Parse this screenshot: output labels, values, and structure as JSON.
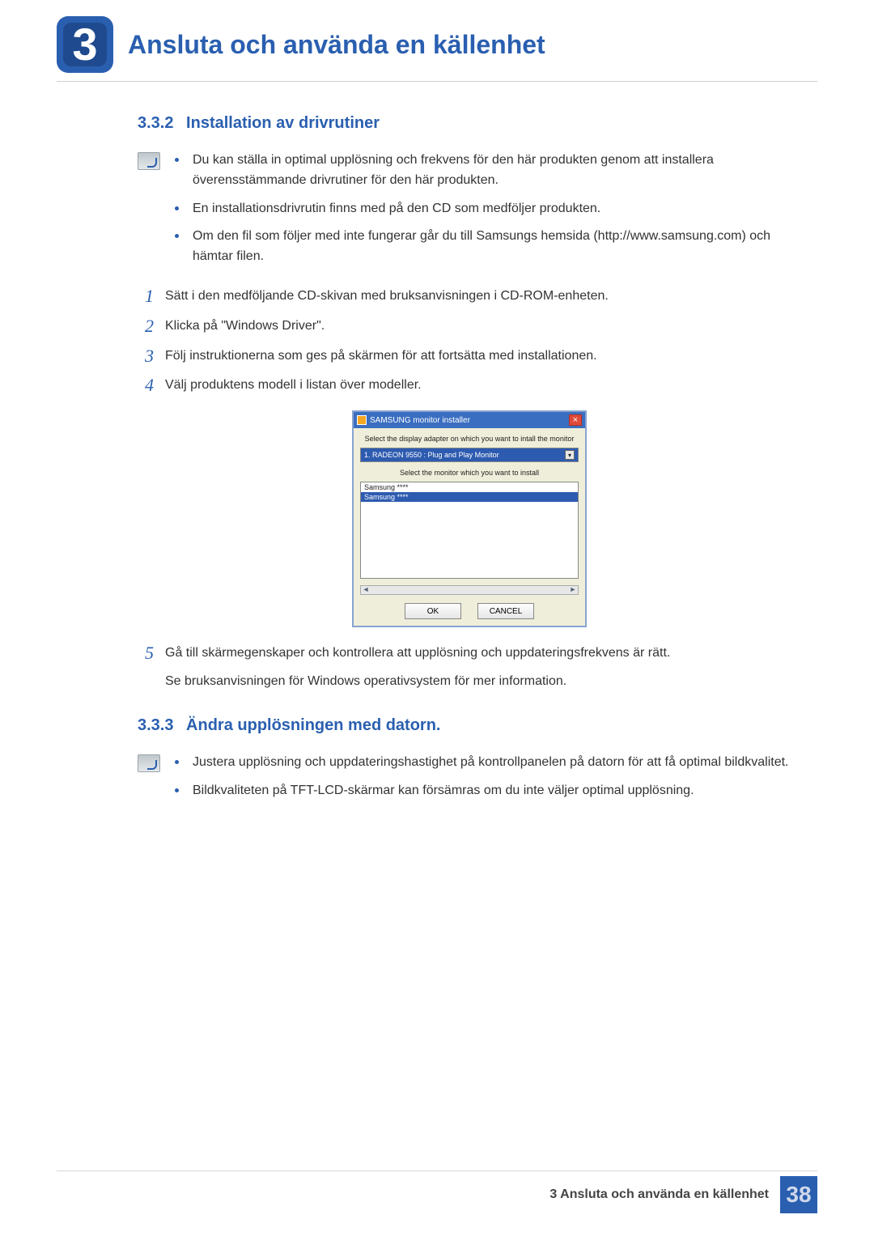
{
  "chapter": {
    "number": "3",
    "title": "Ansluta och använda en källenhet"
  },
  "sections": {
    "s1": {
      "num": "3.3.2",
      "title": "Installation av drivrutiner",
      "notes": [
        "Du kan ställa in optimal upplösning och frekvens för den här produkten genom att installera överensstämmande drivrutiner för den här produkten.",
        "En installationsdrivrutin finns med på den CD som medföljer produkten.",
        "Om den fil som följer med inte fungerar går du till Samsungs hemsida (http://www.samsung.com) och hämtar filen."
      ],
      "steps": [
        {
          "n": "1",
          "text": "Sätt i den medföljande CD-skivan med bruksanvisningen i CD-ROM-enheten."
        },
        {
          "n": "2",
          "text": "Klicka på \"Windows Driver\"."
        },
        {
          "n": "3",
          "text": "Följ instruktionerna som ges på skärmen för att fortsätta med installationen."
        },
        {
          "n": "4",
          "text": "Välj produktens modell i listan över modeller."
        },
        {
          "n": "5",
          "text": "Gå till skärmegenskaper och kontrollera att upplösning och uppdateringsfrekvens är rätt.",
          "sub": "Se bruksanvisningen för Windows operativsystem för mer information."
        }
      ]
    },
    "s2": {
      "num": "3.3.3",
      "title": "Ändra upplösningen med datorn.",
      "notes": [
        "Justera upplösning och uppdateringshastighet på kontrollpanelen på datorn för att få optimal bildkvalitet.",
        "Bildkvaliteten på TFT-LCD-skärmar kan försämras om du inte väljer optimal upplösning."
      ]
    }
  },
  "installer": {
    "title": "SAMSUNG monitor installer",
    "label1": "Select the display adapter on which you want to intall the monitor",
    "select_value": "1. RADEON 9550 : Plug and Play Monitor",
    "label2": "Select the monitor which you want to install",
    "list_item1": "Samsung ****",
    "list_item2": "Samsung ****",
    "ok": "OK",
    "cancel": "CANCEL",
    "close_glyph": "×",
    "dd_glyph": "▾",
    "arrow_left": "◄",
    "arrow_right": "►"
  },
  "footer": {
    "text": "3 Ansluta och använda en källenhet",
    "page": "38"
  }
}
